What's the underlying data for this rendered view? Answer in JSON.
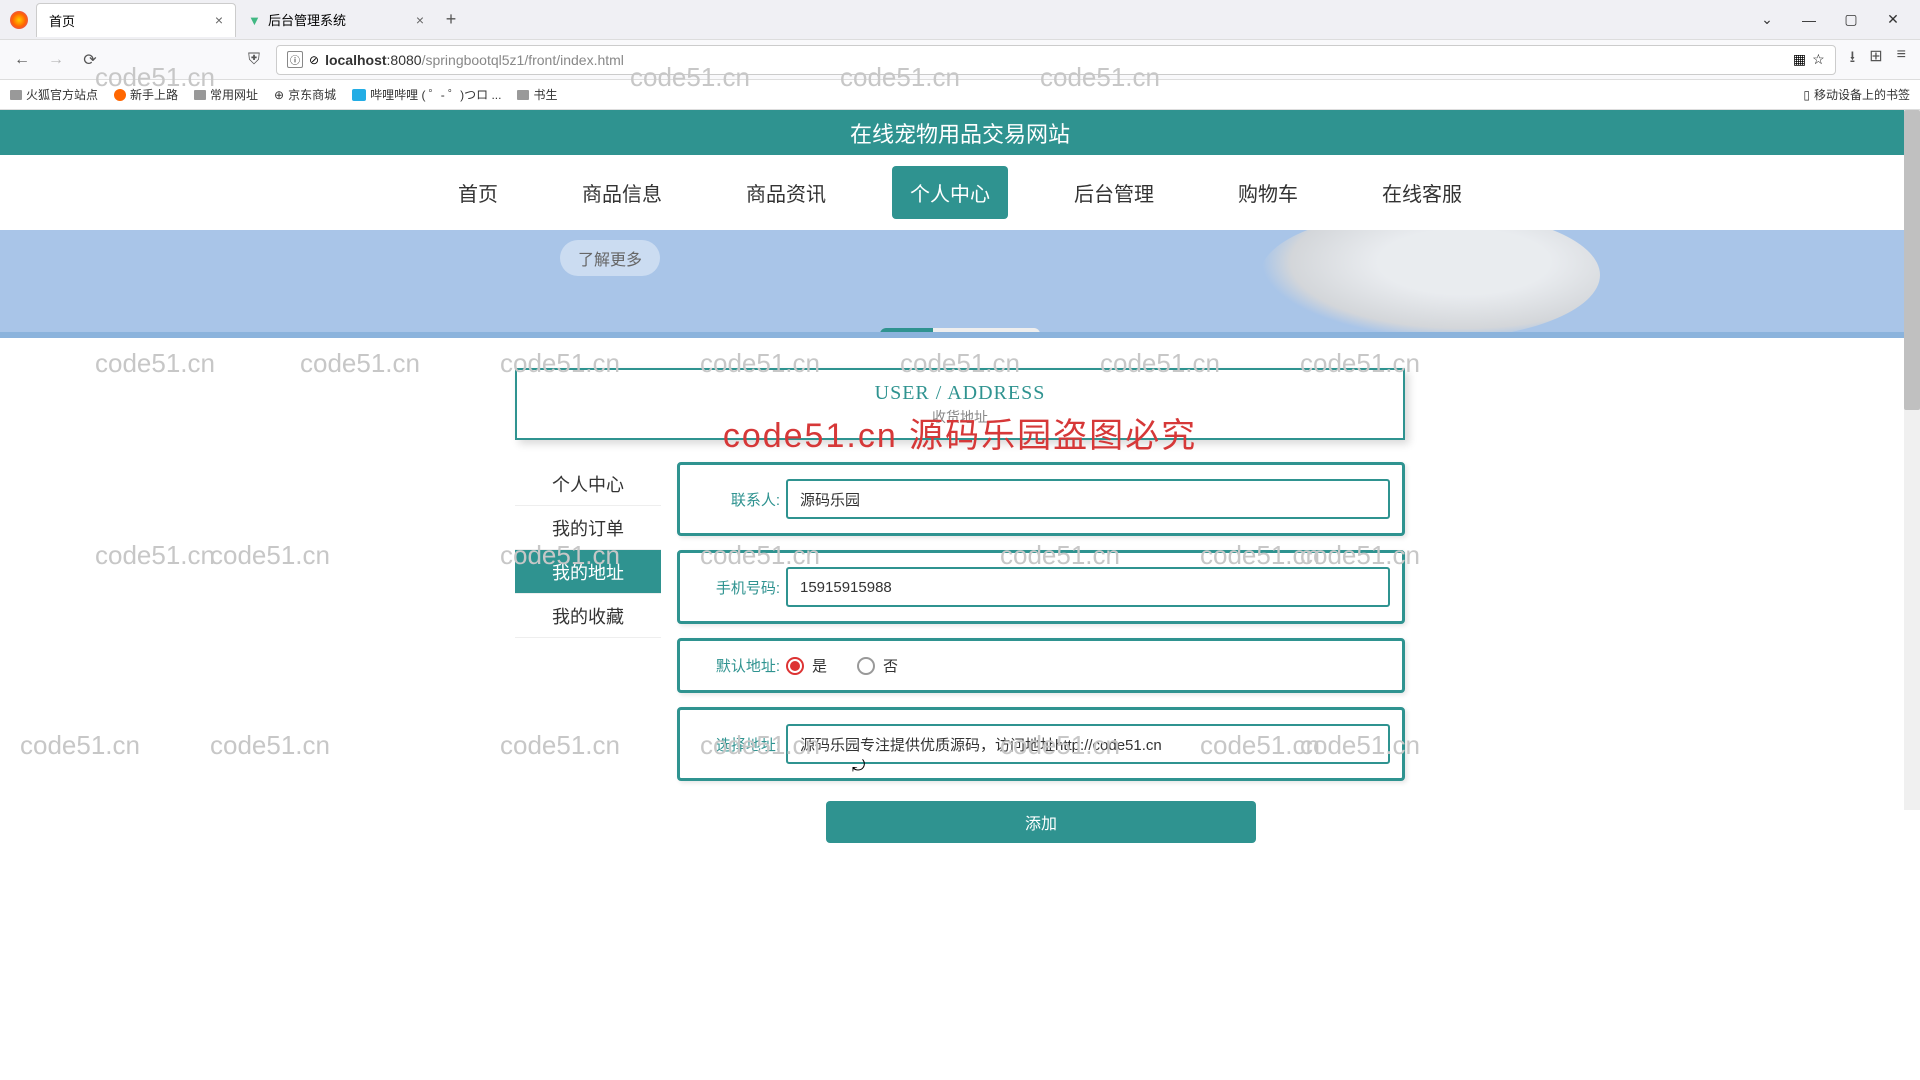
{
  "browser": {
    "tabs": [
      {
        "title": "首页",
        "active": true
      },
      {
        "title": "后台管理系统",
        "active": false
      }
    ],
    "url_host": "localhost",
    "url_port": ":8080",
    "url_path": "/springbootql5z1/front/index.html"
  },
  "bookmarks": {
    "items": [
      "火狐官方站点",
      "新手上路",
      "常用网址",
      "京东商城",
      "哔哩哔哩 (  ゜- ゜)つロ ...",
      "书生"
    ],
    "right": "移动设备上的书签"
  },
  "page": {
    "site_title": "在线宠物用品交易网站",
    "nav": [
      "首页",
      "商品信息",
      "商品资讯",
      "个人中心",
      "后台管理",
      "购物车",
      "在线客服"
    ],
    "nav_active_index": 3,
    "banner_btn": "了解更多",
    "section_en": "USER / ADDRESS",
    "section_cn": "收货地址",
    "side_menu": [
      "个人中心",
      "我的订单",
      "我的地址",
      "我的收藏"
    ],
    "side_active_index": 2,
    "form": {
      "contact_label": "联系人:",
      "contact_value": "源码乐园",
      "phone_label": "手机号码:",
      "phone_value": "15915915988",
      "default_label": "默认地址:",
      "radio_yes": "是",
      "radio_no": "否",
      "addr_label": "选择地址:",
      "addr_value": "源码乐园专注提供优质源码，访问地址http://code51.cn",
      "submit": "添加"
    }
  },
  "watermark": {
    "text": "code51.cn",
    "big": "code51.cn 源码乐园盗图必究"
  }
}
